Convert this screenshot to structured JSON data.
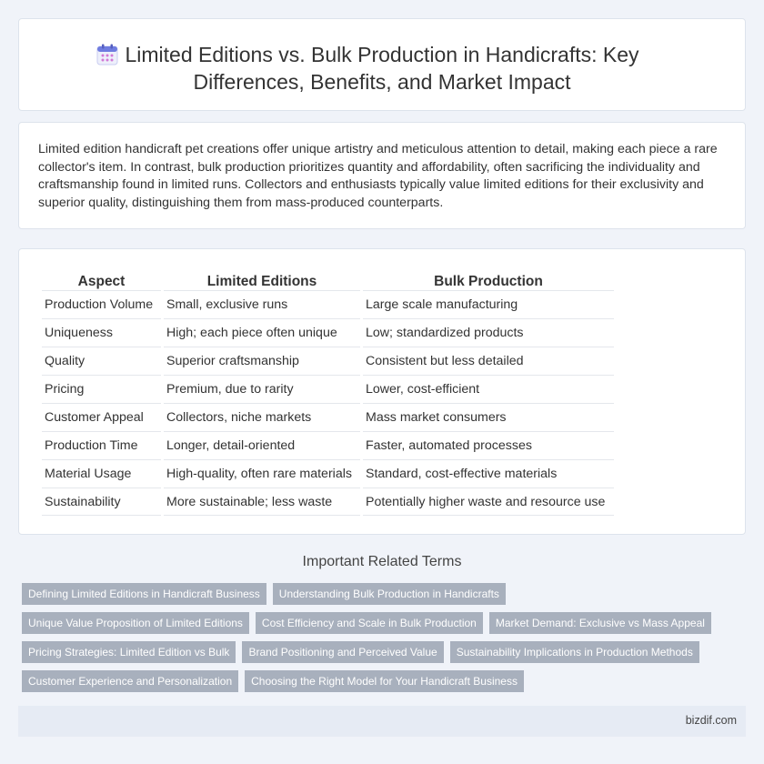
{
  "header": {
    "icon": "calendar-icon",
    "title": "Limited Editions vs. Bulk Production in Handicrafts: Key Differences, Benefits, and Market Impact"
  },
  "intro": "Limited edition handicraft pet creations offer unique artistry and meticulous attention to detail, making each piece a rare collector's item. In contrast, bulk production prioritizes quantity and affordability, often sacrificing the individuality and craftsmanship found in limited runs. Collectors and enthusiasts typically value limited editions for their exclusivity and superior quality, distinguishing them from mass-produced counterparts.",
  "table": {
    "headers": [
      "Aspect",
      "Limited Editions",
      "Bulk Production"
    ],
    "rows": [
      [
        "Production Volume",
        "Small, exclusive runs",
        "Large scale manufacturing"
      ],
      [
        "Uniqueness",
        "High; each piece often unique",
        "Low; standardized products"
      ],
      [
        "Quality",
        "Superior craftsmanship",
        "Consistent but less detailed"
      ],
      [
        "Pricing",
        "Premium, due to rarity",
        "Lower, cost-efficient"
      ],
      [
        "Customer Appeal",
        "Collectors, niche markets",
        "Mass market consumers"
      ],
      [
        "Production Time",
        "Longer, detail-oriented",
        "Faster, automated processes"
      ],
      [
        "Material Usage",
        "High-quality, often rare materials",
        "Standard, cost-effective materials"
      ],
      [
        "Sustainability",
        "More sustainable; less waste",
        "Potentially higher waste and resource use"
      ]
    ]
  },
  "related": {
    "heading": "Important Related Terms",
    "rows": [
      [
        "Defining Limited Editions in Handicraft Business",
        "Understanding Bulk Production in Handicrafts"
      ],
      [
        "Unique Value Proposition of Limited Editions",
        "Cost Efficiency and Scale in Bulk Production",
        "Market Demand: Exclusive vs Mass Appeal"
      ],
      [
        "Pricing Strategies: Limited Edition vs Bulk",
        "Brand Positioning and Perceived Value",
        "Sustainability Implications in Production Methods"
      ],
      [
        "Customer Experience and Personalization",
        "Choosing the Right Model for Your Handicraft Business"
      ]
    ]
  },
  "footer": {
    "site": "bizdif.com"
  }
}
